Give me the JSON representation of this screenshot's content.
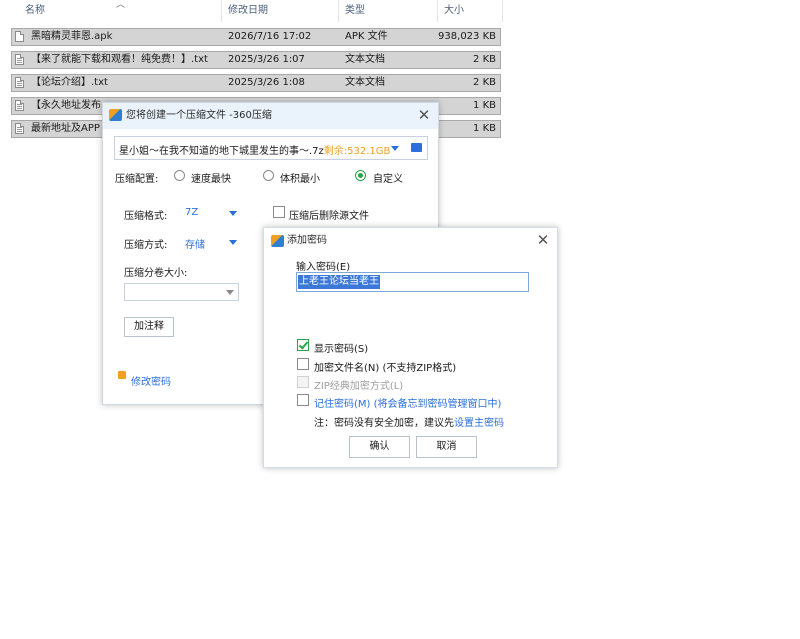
{
  "columns": {
    "name": "名称",
    "modified": "修改日期",
    "type": "类型",
    "size": "大小"
  },
  "files": [
    {
      "name": "黑暗精灵菲恩.apk",
      "date": "2026/7/16 17:02",
      "type": "APK 文件",
      "size": "938,023 KB",
      "icon": "file-icon"
    },
    {
      "name": "【来了就能下载和观看！纯免费！】.txt",
      "date": "2025/3/26 1:07",
      "type": "文本文档",
      "size": "2 KB",
      "icon": "text-file-icon"
    },
    {
      "name": "【论坛介绍】.txt",
      "date": "2025/3/26 1:08",
      "type": "文本文档",
      "size": "2 KB",
      "icon": "text-file-icon"
    },
    {
      "name": "【永久地址发布",
      "date": "",
      "type": "",
      "size": "1 KB",
      "icon": "text-file-icon"
    },
    {
      "name": "最新地址及APP",
      "date": "",
      "type": "",
      "size": "1 KB",
      "icon": "text-file-icon"
    }
  ],
  "compress_dialog": {
    "title": "您将创建一个压缩文件 -360压缩",
    "filename": "星小姐～在我不知道的地下城里发生的事～.7z",
    "free_space": "剩余:532.1GB",
    "config_label": "压缩配置:",
    "options": [
      "速度最快",
      "体积最小",
      "自定义"
    ],
    "selected_option": "自定义",
    "format_label": "压缩格式:",
    "format_value": "7Z",
    "method_label": "压缩方式:",
    "method_value": "存储",
    "volume_label": "压缩分卷大小:",
    "delete_source_label": "压缩后删除源文件",
    "comment_button": "加注释",
    "change_password_link": "修改密码"
  },
  "password_dialog": {
    "title": "添加密码",
    "input_label": "输入密码(E)",
    "password_value": "上老王论坛当老王",
    "show_password": "显示密码(S)",
    "encrypt_names": "加密文件名(N) (不支持ZIP格式)",
    "zip_classic": "ZIP经典加密方式(L)",
    "remember_password": "记住密码(M) (将会备忘到密码管理窗口中)",
    "note_prefix": "注：密码没有安全加密，建议先",
    "note_link": "设置主密码",
    "ok_button": "确认",
    "cancel_button": "取消"
  },
  "colors": {
    "accent": "#2a6fdb",
    "free_space": "#f0a020",
    "check_green": "#2aa34a",
    "selection": "#d4d4d4"
  }
}
